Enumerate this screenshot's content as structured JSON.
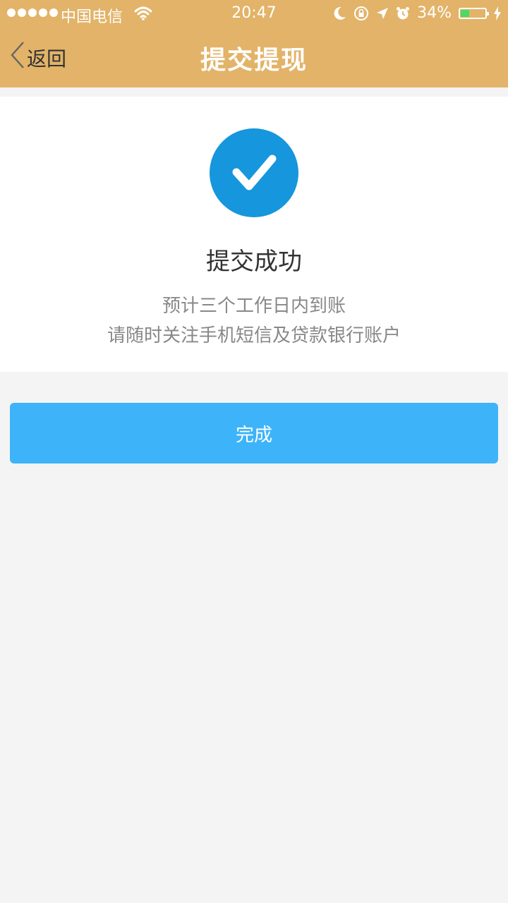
{
  "status_bar": {
    "carrier": "中国电信",
    "time": "20:47",
    "battery_percent": "34%",
    "battery_level": 0.34,
    "icons": [
      "signal-dots-icon",
      "wifi-icon",
      "moon-icon",
      "rotation-lock-icon",
      "location-arrow-icon",
      "alarm-icon",
      "battery-icon",
      "charging-bolt-icon"
    ]
  },
  "nav": {
    "back_label": "返回",
    "title": "提交提现"
  },
  "result": {
    "icon": "check-circle-icon",
    "title": "提交成功",
    "line1": "预计三个工作日内到账",
    "line2": "请随时关注手机短信及贷款银行账户"
  },
  "actions": {
    "done_label": "完成"
  },
  "colors": {
    "header": "#e2b368",
    "check_circle": "#1696dc",
    "button": "#3db4f9",
    "battery_fill": "#4cd964",
    "page_bg": "#f4f4f4"
  }
}
